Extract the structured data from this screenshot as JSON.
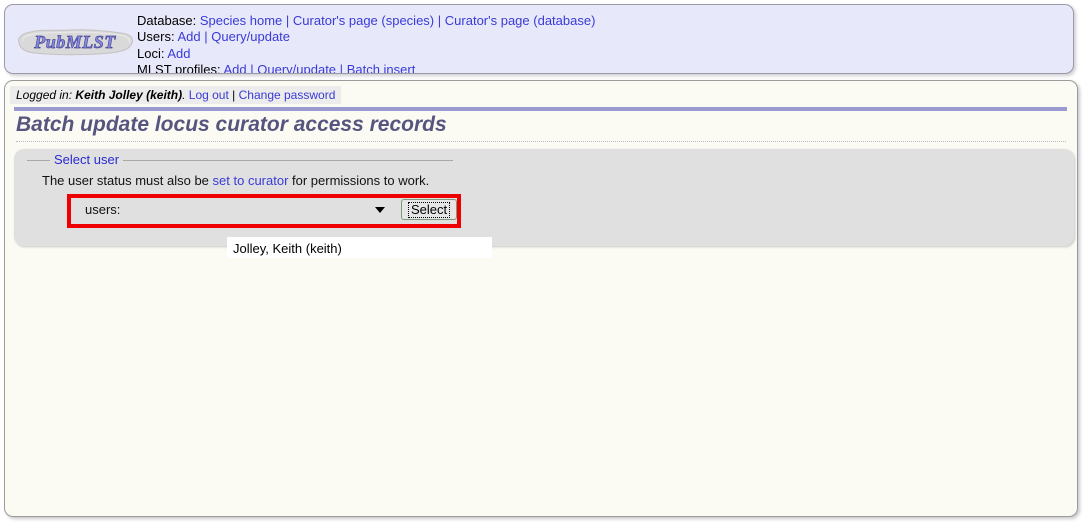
{
  "header": {
    "logo_text": "PubMLST",
    "nav": [
      {
        "label": "Database:",
        "links": [
          "Species home",
          "Curator's page (species)",
          "Curator's page (database)"
        ]
      },
      {
        "label": "Users:",
        "links": [
          "Add",
          "Query/update"
        ]
      },
      {
        "label": "Loci:",
        "links": [
          "Add"
        ]
      },
      {
        "label": "MLST profiles:",
        "links": [
          "Add",
          "Query/update",
          "Batch insert"
        ]
      }
    ],
    "separator": "|"
  },
  "login": {
    "prefix": "Logged in:",
    "user": "Keith Jolley (keith)",
    "suffix": ".",
    "logout_label": "Log out",
    "separator": "|",
    "change_password_label": "Change password"
  },
  "page": {
    "title": "Batch update locus curator access records"
  },
  "select_user": {
    "legend": "Select user",
    "helper_text_before": "The user status must also be ",
    "helper_link": "set to curator",
    "helper_text_after": " for permissions to work.",
    "field_label": "users:",
    "selected_user": "Jolley, Keith (keith)",
    "options": [
      "Jolley, Keith (keith)"
    ],
    "submit_label": "Select"
  },
  "colors": {
    "link": "#3a3ad8",
    "header_bg": "#e8e8fb",
    "panel_bg": "#e0e0e0",
    "content_bg": "#fbfbf4",
    "title": "#55557f",
    "highlight": "#ee0000"
  }
}
